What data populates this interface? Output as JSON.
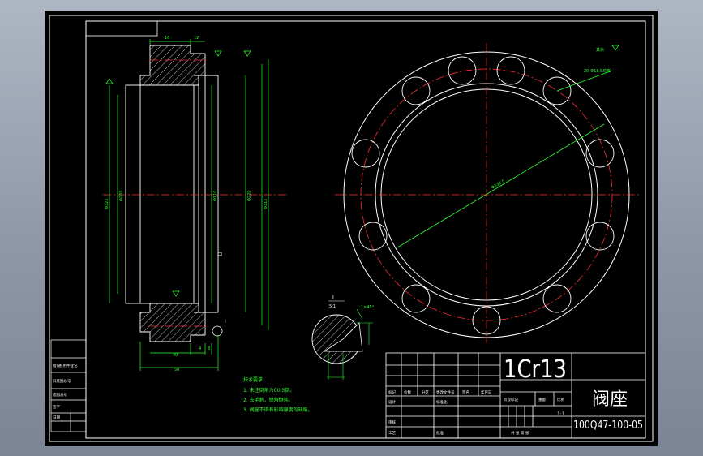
{
  "drawing": {
    "material": "1Cr13",
    "part_name": "阀座",
    "drawing_number": "100Q47-100-05",
    "scale": "1:1",
    "tech_requirements": {
      "heading": "技术要求",
      "items": [
        "1. 未注倒角为C0.5倒。",
        "2. 去毛刺，锐角倒钝。",
        "3. 阀座不得有影响强度的缺陷。"
      ]
    },
    "surface_finish_other": "其余",
    "detail_view": {
      "label": "I",
      "scale": "5:1"
    },
    "callouts": {
      "bolt_holes": "20-Φ18.5均布",
      "bolt_circle": "Φ238.5",
      "chamfer": "1×45°",
      "detail_marker": "I"
    },
    "section_dimensions": {
      "top": [
        "16",
        "12"
      ],
      "bottom": [
        "4",
        "8",
        "40",
        "50"
      ],
      "diameters": [
        "Φ322",
        "Φ260",
        "Φ110",
        "Φ220",
        "Φ312"
      ]
    },
    "title_block": {
      "row_labels": [
        "标记",
        "处数",
        "分区",
        "更改文件号",
        "签名",
        "年月日"
      ],
      "design": "设计",
      "standardize": "标准化",
      "check": "审核",
      "process": "工艺",
      "approve": "批准",
      "stage_marks": "阶段标记",
      "weight": "重量",
      "scale_label": "比例",
      "sheet_total": "共  张  第  张"
    },
    "left_strip": [
      "借(通)用件登记",
      "旧底图总号",
      "底图总号",
      "签字",
      "日期"
    ]
  }
}
